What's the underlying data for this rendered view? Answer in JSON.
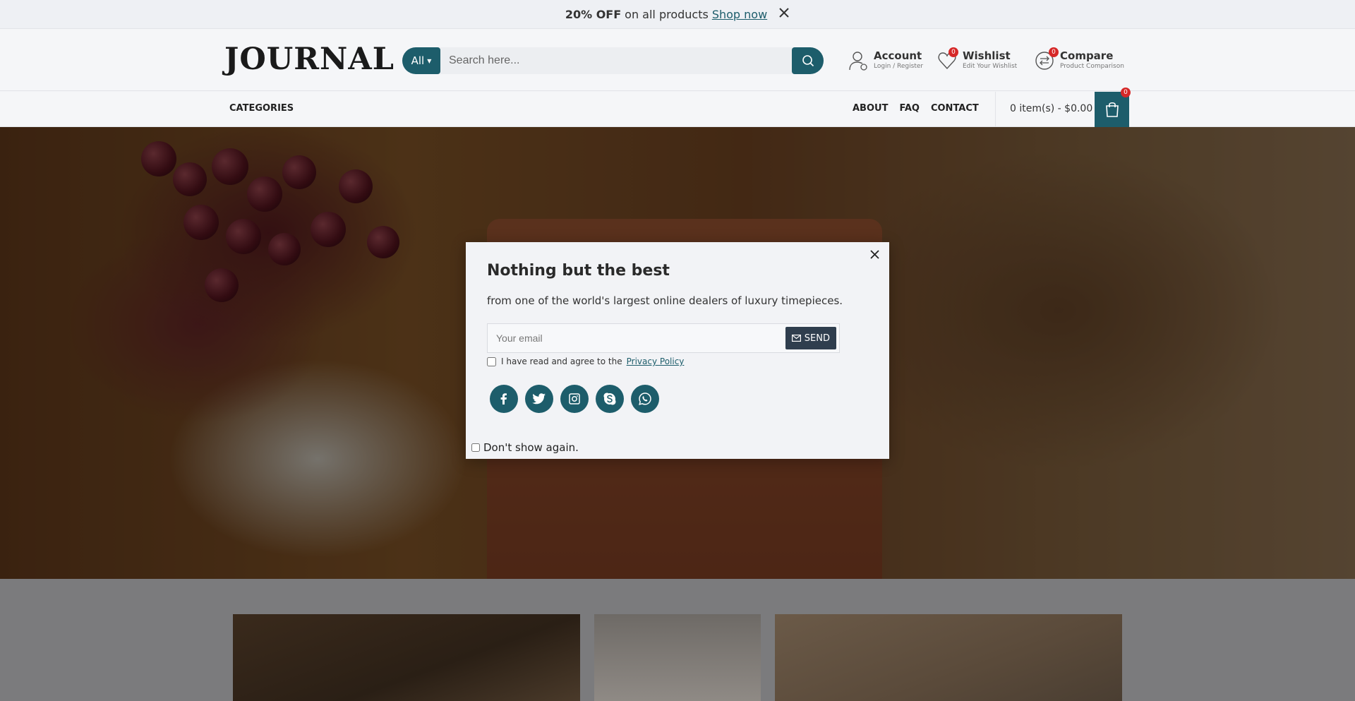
{
  "promo": {
    "bold": "20% OFF",
    "text": "on all products",
    "link": "Shop now"
  },
  "header": {
    "logo": "JOURNAL",
    "search": {
      "category": "All",
      "placeholder": "Search here..."
    },
    "account": {
      "title": "Account",
      "sub": "Login / Register"
    },
    "wishlist": {
      "title": "Wishlist",
      "sub": "Edit Your Wishlist",
      "count": "0"
    },
    "compare": {
      "title": "Compare",
      "sub": "Product Comparison",
      "count": "0"
    }
  },
  "nav": {
    "categories": "CATEGORIES",
    "links": [
      "ABOUT",
      "FAQ",
      "CONTACT"
    ],
    "cart_text": "0 item(s) - $0.00",
    "cart_count": "0"
  },
  "modal": {
    "title": "Nothing but the best",
    "subtitle": "from one of the world's largest online dealers of luxury timepieces.",
    "email_placeholder": "Your email",
    "send_label": "SEND",
    "agree_text": "I have read and agree to the",
    "privacy_link": "Privacy Policy",
    "socials": [
      "facebook",
      "twitter",
      "instagram",
      "skype",
      "whatsapp"
    ],
    "dont_show": "Don't show again."
  },
  "colors": {
    "accent": "#1d5d6b",
    "badge": "#d62828",
    "send_button": "#2f3e4e"
  }
}
